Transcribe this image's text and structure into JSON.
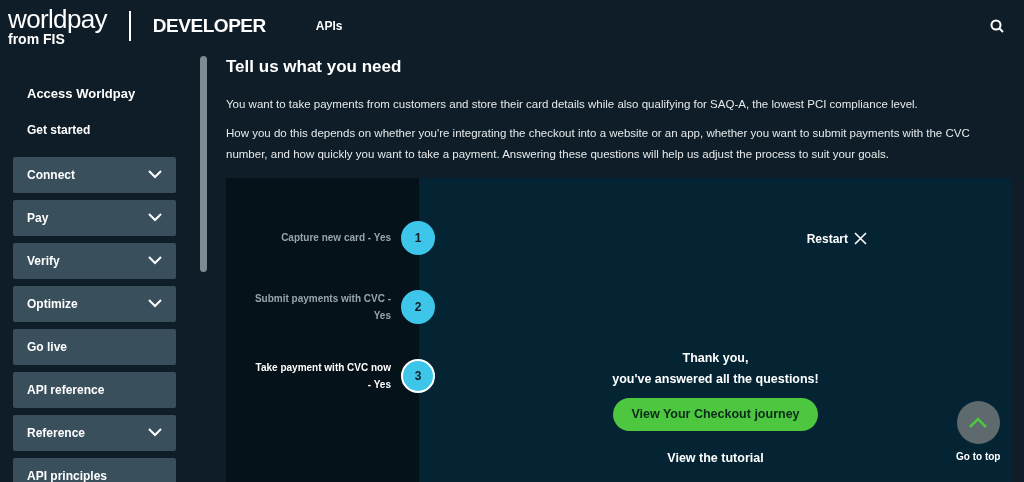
{
  "header": {
    "logo": "worldpay",
    "logo_sub": "from FIS",
    "section": "DEVELOPER",
    "nav": [
      "APIs"
    ]
  },
  "sidebar": {
    "heading": "Access Worldpay",
    "link": "Get started",
    "items": [
      {
        "label": "Connect",
        "expandable": true
      },
      {
        "label": "Pay",
        "expandable": true
      },
      {
        "label": "Verify",
        "expandable": true
      },
      {
        "label": "Optimize",
        "expandable": true
      },
      {
        "label": "Go live",
        "expandable": false
      },
      {
        "label": "API reference",
        "expandable": false
      },
      {
        "label": "Reference",
        "expandable": true
      },
      {
        "label": "API principles",
        "expandable": false
      }
    ]
  },
  "main": {
    "title": "Tell us what you need",
    "paragraphs": [
      "You want to take payments from customers and store their card details while also qualifying for SAQ-A, the lowest PCI compliance level.",
      "How you do this depends on whether you're integrating the checkout into a website or an app, whether you want to submit payments with the CVC number, and how quickly you want to take a payment. Answering these questions will help us adjust the process to suit your goals."
    ],
    "steps": [
      {
        "label": "Capture new card - Yes",
        "number": "1",
        "selected": false
      },
      {
        "label": "Submit payments with CVC - Yes",
        "number": "2",
        "selected": false
      },
      {
        "label": "Take payment with CVC now - Yes",
        "number": "3",
        "selected": true
      }
    ],
    "restart": "Restart",
    "thanks": [
      "Thank you,",
      "you've answered all the questions!"
    ],
    "cta": "View Your Checkout journey",
    "tutorial": "View the tutorial"
  },
  "go_to_top": "Go to top"
}
